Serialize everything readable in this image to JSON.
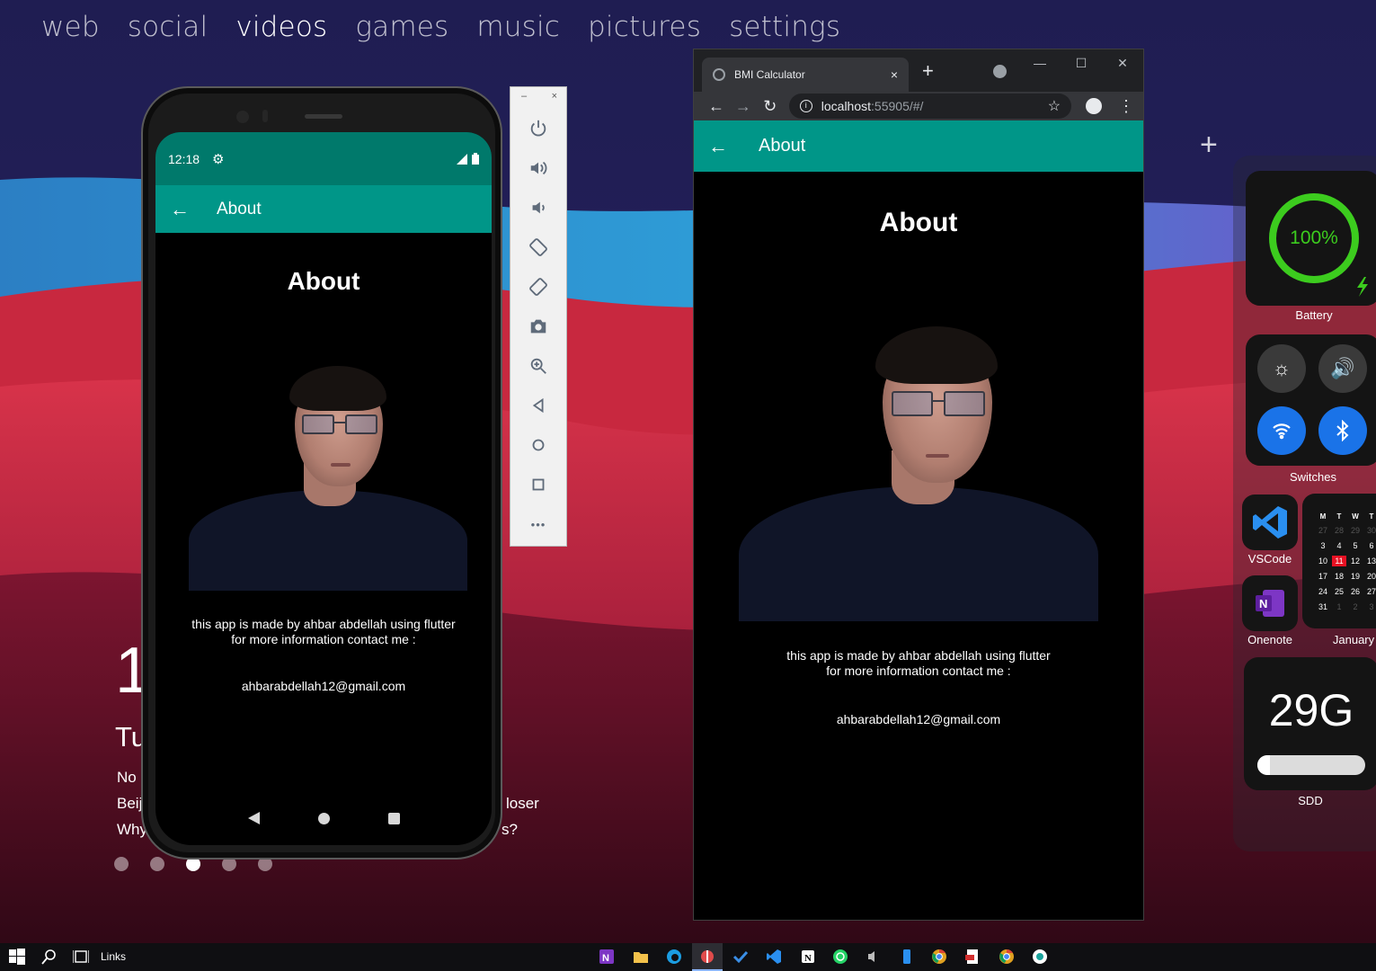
{
  "topnav": [
    "web",
    "social",
    "videos",
    "games",
    "music",
    "pictures",
    "settings"
  ],
  "news": {
    "date_digit": "1",
    "day_fragment": "Tu",
    "lines": [
      "No",
      "Beij",
      "Why"
    ],
    "tails": [
      "loser",
      "s?"
    ]
  },
  "phone": {
    "time": "12:18",
    "appbar_title": "About",
    "heading": "About",
    "description_line1": "this app is made by ahbar abdellah using flutter",
    "description_line2": "for more information contact me :",
    "email": "ahbarabdellah12@gmail.com"
  },
  "emulator": {
    "minimize": "–",
    "close": "×",
    "more": "•••"
  },
  "browser": {
    "tab_title": "BMI Calculator",
    "tab_close": "×",
    "new_tab": "+",
    "win_min": "—",
    "win_max": "☐",
    "win_close": "✕",
    "url_host": "localhost",
    "url_path": ":55905/#/",
    "page_appbar_title": "About",
    "page_heading": "About",
    "description_line1": "this app is made by ahbar abdellah using flutter",
    "description_line2": "for more information contact me :",
    "email": "ahbarabdellah12@gmail.com"
  },
  "widgets": {
    "add": "+",
    "battery_percent": "100%",
    "battery_level": 1.0,
    "battery_label": "Battery",
    "switches_label": "Switches",
    "vscode_label": "VSCode",
    "onenote_label": "Onenote",
    "calendar_label": "January",
    "calendar_header": [
      "M",
      "T",
      "W",
      "T"
    ],
    "calendar_rows": [
      [
        "27",
        "28",
        "29",
        "30"
      ],
      [
        "3",
        "4",
        "5",
        "6"
      ],
      [
        "10",
        "11",
        "12",
        "13"
      ],
      [
        "17",
        "18",
        "19",
        "20"
      ],
      [
        "24",
        "25",
        "26",
        "27"
      ],
      [
        "31",
        "1",
        "2",
        "3"
      ]
    ],
    "calendar_today": "11",
    "storage_value": "29G",
    "storage_fill": 0.12,
    "storage_label": "SDD",
    "accent_green": "#3ccc1e",
    "accent_blue": "#1a73e8"
  },
  "taskbar": {
    "links_label": "Links"
  },
  "colors": {
    "teal": "#009688",
    "teal_dark": "#00796b"
  }
}
